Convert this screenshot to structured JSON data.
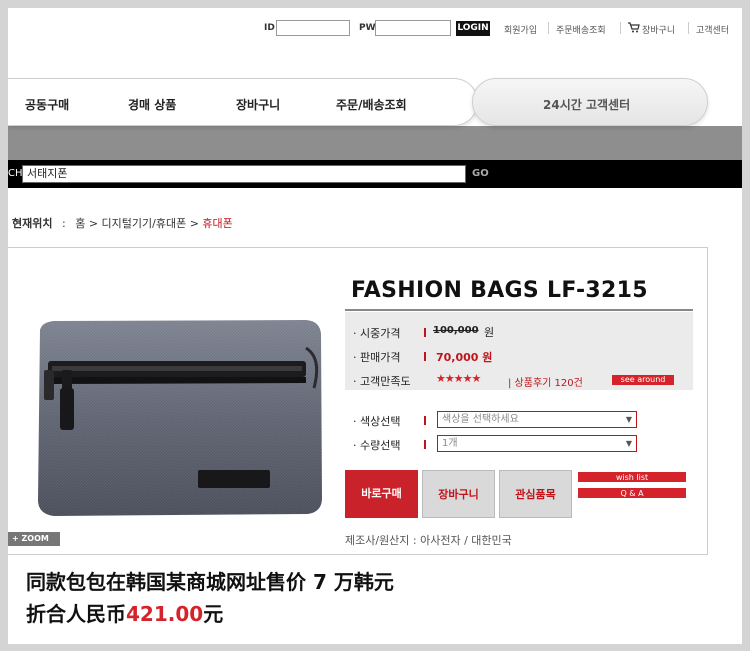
{
  "login": {
    "id_label": "ID",
    "pw_label": "PW",
    "login_button": "LOGIN",
    "links": [
      "회원가입",
      "주문배송조회",
      "장바구니",
      "고객센터"
    ]
  },
  "nav": {
    "items": [
      "공동구매",
      "경매 상품",
      "장바구니",
      "주문/배송조회"
    ],
    "customer_center": "24시간 고객센터"
  },
  "search": {
    "prefix": "CH",
    "value": "서태지폰",
    "go_label": "GO"
  },
  "breadcrumb": {
    "head": "현재위치",
    "colon": ":",
    "path": "홈 > 디지털기기/휴대폰 >",
    "current": "휴대폰"
  },
  "product": {
    "title": "FASHION BAGS LF-3215",
    "zoom_label": "+ ZOOM",
    "list_price_label": "· 시중가격",
    "list_price": "100,000",
    "list_price_unit": "원",
    "sale_price_label": "· 판매가격",
    "sale_price": "70,000 원",
    "rating_label": "· 고객만족도",
    "stars": "★★★★★",
    "review": "| 상품후기 120건",
    "see_around": "see around",
    "color_label": "· 색상선택",
    "color_select": "색상을 선택하세요",
    "qty_label": "· 수량선택",
    "qty_select": "1개",
    "buy_button": "바로구매",
    "cart_button": "장바구니",
    "wish_button": "관심품목",
    "wish_list": "wish list",
    "qa": "Q & A",
    "maker": "제조사/원산지   :   아사전자 / 대한민국"
  },
  "note": {
    "line1": "同款包包在韩国某商城网址售价 7 万韩元",
    "line2_prefix": "折合人民币",
    "line2_price": "421.00",
    "line2_suffix": "元"
  },
  "colors": {
    "accent_red": "#c0141b",
    "star_red": "#d4232a"
  }
}
